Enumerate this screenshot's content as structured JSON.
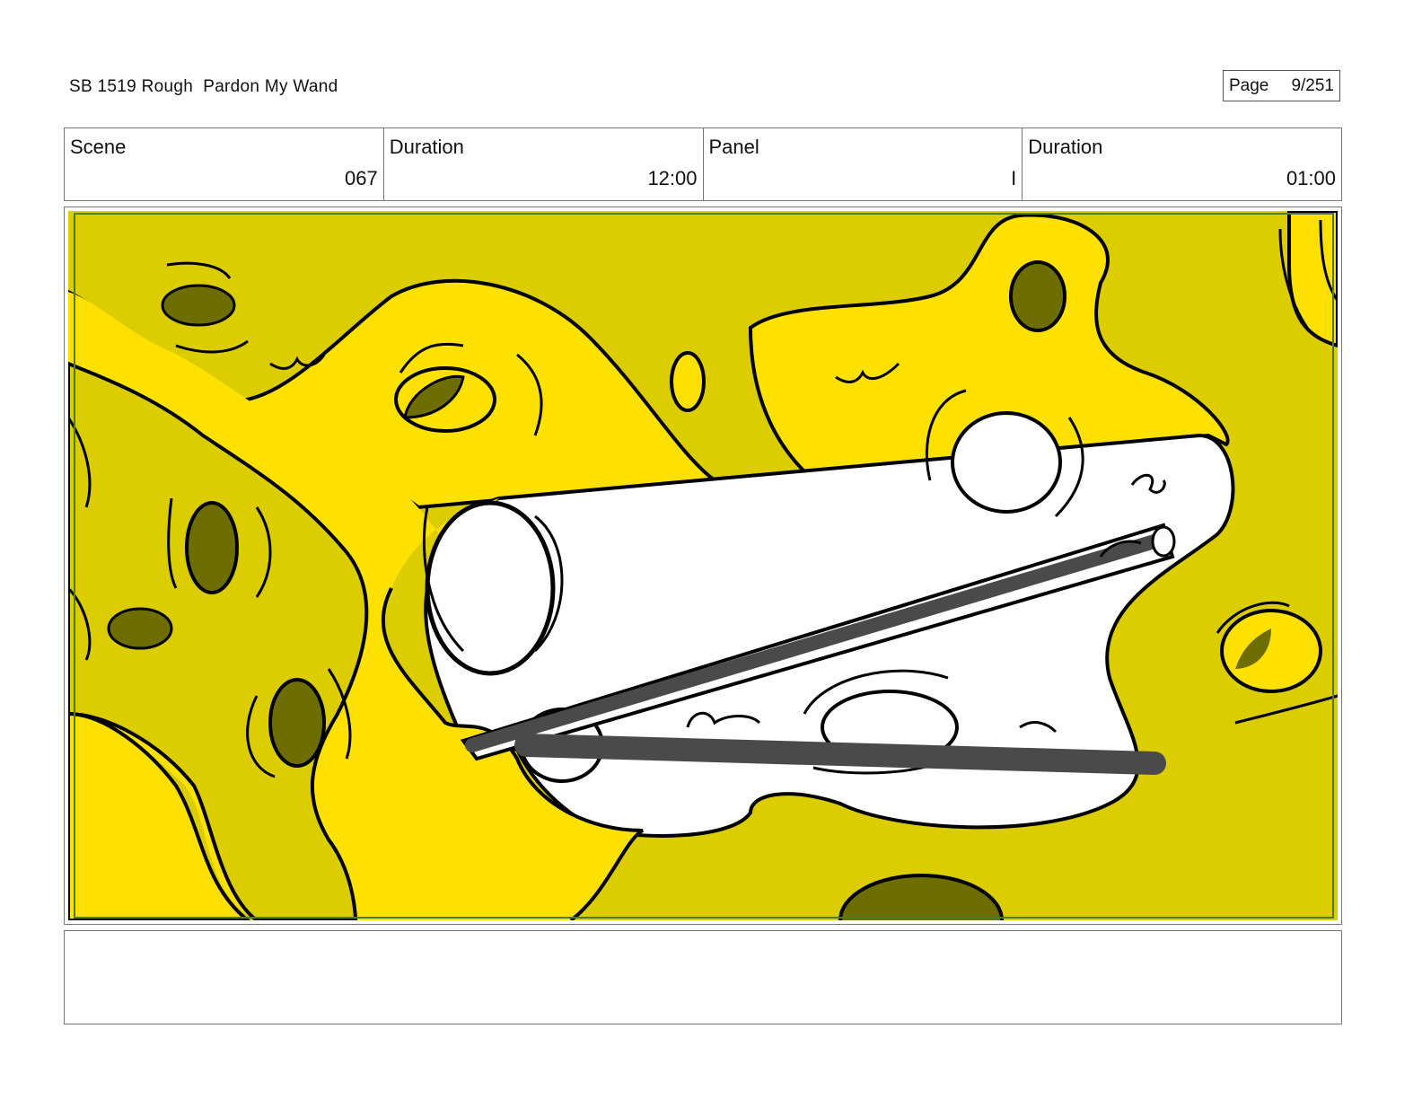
{
  "header": {
    "title": "SB 1519 Rough  Pardon My Wand",
    "page_label": "Page",
    "page_value": "9/251"
  },
  "info": {
    "scene_label": "Scene",
    "scene_value": "067",
    "scene_duration_label": "Duration",
    "scene_duration_value": "12:00",
    "panel_label": "Panel",
    "panel_value": "I",
    "panel_duration_label": "Duration",
    "panel_duration_value": "01:00"
  },
  "panel": {
    "colors": {
      "background": "#dccd00",
      "cheese_light": "#ffe100",
      "holes": "#6e6e00",
      "highlight": "#ffffff",
      "wand": "#4a4a4a",
      "ink": "#000000",
      "safe_frame": "#4f7a2a"
    }
  },
  "notes": {
    "text": ""
  }
}
